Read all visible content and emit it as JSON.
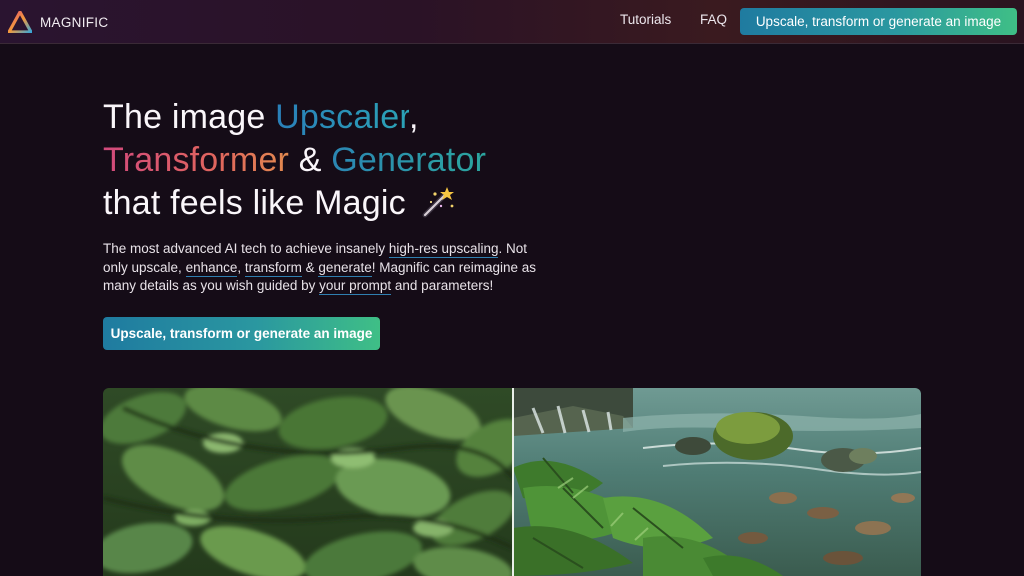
{
  "header": {
    "brand": "MAGNIFIC",
    "nav": {
      "tutorials": "Tutorials",
      "faq": "FAQ"
    },
    "cta_label": "Upscale, transform or generate an image"
  },
  "hero": {
    "title": {
      "line1_pre": "The image ",
      "upscaler": "Upscaler",
      "comma": ",",
      "transformer": "Transformer",
      "amp": " & ",
      "generator": "Generator",
      "line3": "that feels like Magic"
    },
    "description": {
      "p1": "The most advanced AI tech to achieve insanely ",
      "link_highres": "high-res upscaling",
      "p2": ". Not only upscale, ",
      "link_enhance": "enhance",
      "p3": ", ",
      "link_transform": "transform",
      "p4": " & ",
      "link_generate": "generate",
      "p5": "! Magnific can reimagine as many details as you wish guided by ",
      "link_prompt": "your prompt",
      "p6": " and parameters!"
    },
    "cta_label": "Upscale, transform or generate an image"
  },
  "comparison": {
    "before_icon": "blurry-leaves-image",
    "after_icon": "sharp-river-jungle-image"
  },
  "colors": {
    "background": "#150c17",
    "accent_start": "#1f7ba0",
    "accent_end": "#3fbf86",
    "pink": "#d24a7d",
    "blue": "#2a7fb8"
  }
}
